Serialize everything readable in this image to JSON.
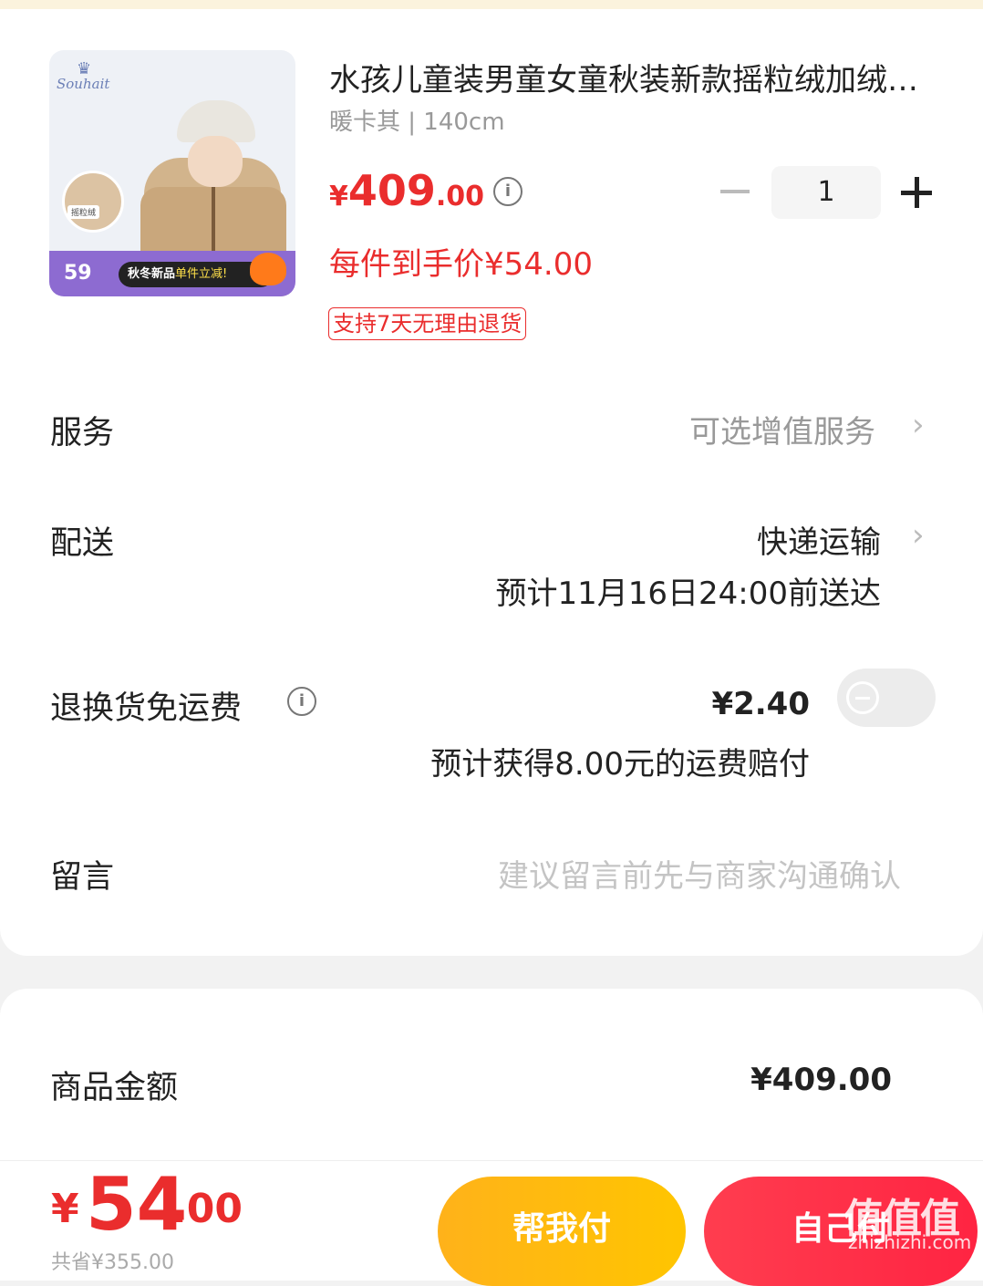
{
  "product": {
    "title": "水孩儿童装男童女童秋装新款摇粒绒加绒外套上衣",
    "spec": "暖卡其 | 140cm",
    "price_symbol": "¥",
    "price_int": "409",
    "price_dec": ".00",
    "unit_price": "每件到手价¥54.00",
    "return_tag": "支持7天无理由退货",
    "quantity": "1",
    "image": {
      "brand": "Souhait",
      "crown": "♛",
      "swatch_label": "摇粒绒",
      "banner_price": "59",
      "banner_text_a": "秋冬新品",
      "banner_text_b": "单件立减!"
    }
  },
  "rows": {
    "service_label": "服务",
    "service_value": "可选增值服务",
    "delivery_label": "配送",
    "delivery_value": "快递运输",
    "delivery_eta": "预计11月16日24:00前送达",
    "freight_label": "退换货免运费",
    "freight_price": "¥2.40",
    "freight_note": "预计获得8.00元的运费赔付",
    "freight_enabled": false,
    "message_label": "留言",
    "message_placeholder": "建议留言前先与商家沟通确认"
  },
  "summary": {
    "goods_label": "商品金额",
    "goods_value": "¥409.00"
  },
  "footer": {
    "total_symbol": "¥",
    "total_int": "54",
    "total_dec": ".00",
    "total_sub": "共省¥355.00",
    "help_pay_label": "帮我付",
    "self_pay_label": "自己付"
  },
  "watermark": {
    "logo": "值值值",
    "site": "zhizhizhi.com"
  },
  "icons": {
    "chevron": "›",
    "info": "i"
  },
  "colors": {
    "accent_red": "#ea2d2d",
    "help_button": "#ffb21a",
    "self_button": "#ff2442"
  }
}
